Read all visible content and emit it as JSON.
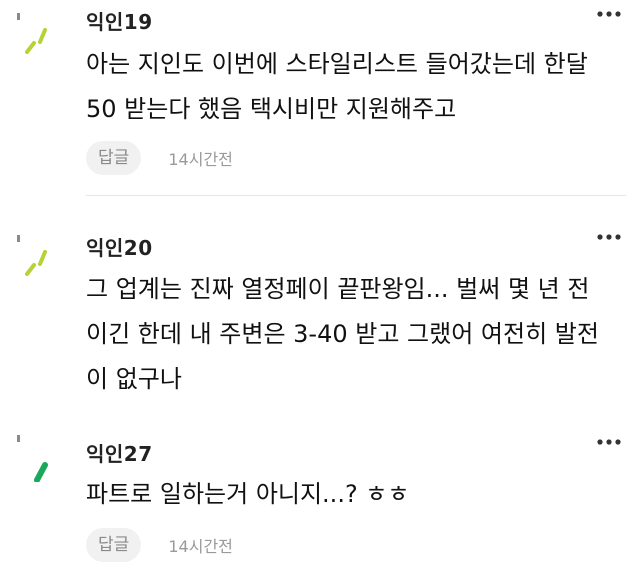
{
  "comments": [
    {
      "author": "익인19",
      "lines": [
        "아는 지인도 이번에 스타일리스트 들어갔는데 한달",
        "50 받는다 했음 택시비만 지원해주고"
      ],
      "reply_label": "답글",
      "time": "14시간전",
      "avatar_icon": "green-dash-avatar-icon",
      "avatar_color": "#b5d334"
    },
    {
      "author": "익인20",
      "lines": [
        "그 업계는 진짜 열정페이 끝판왕임... 벌써 몇 년 전",
        "이긴 한데 내 주변은 3-40 받고 그랬어 여전히 발전",
        "이 없구나"
      ],
      "avatar_icon": "green-dash-avatar-icon",
      "avatar_color": "#b5d334"
    },
    {
      "author": "익인27",
      "lines": [
        "파트로 일하는거 아니지...? ㅎㅎ"
      ],
      "reply_label": "답글",
      "time": "14시간전",
      "avatar_icon": "green-slash-avatar-icon",
      "avatar_color": "#1aa85a"
    }
  ],
  "more_icon": "more-options-icon",
  "colors": {
    "lime": "#b5d334",
    "green": "#1aa85a",
    "reply_bg": "#f1f1f1",
    "muted_text": "#9a9a9a"
  }
}
